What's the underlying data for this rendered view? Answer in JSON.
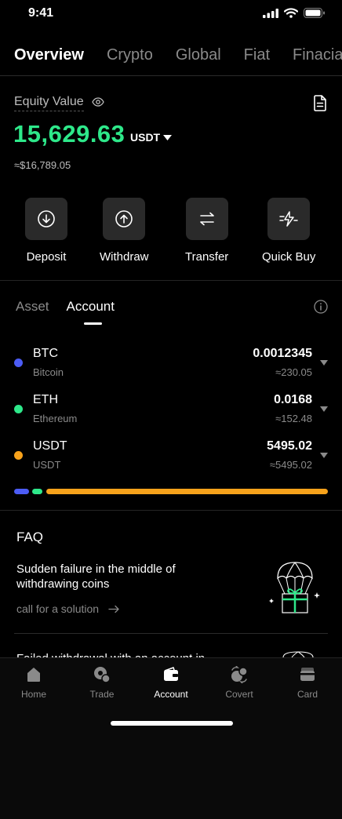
{
  "status_bar": {
    "time": "9:41"
  },
  "top_tabs": [
    {
      "label": "Overview",
      "active": true
    },
    {
      "label": "Crypto"
    },
    {
      "label": "Global"
    },
    {
      "label": "Fiat"
    },
    {
      "label": "Finacial"
    }
  ],
  "equity": {
    "label": "Equity Value",
    "value": "15,629.63",
    "currency": "USDT",
    "approx": "≈$16,789.05"
  },
  "actions": [
    {
      "label": "Deposit",
      "icon": "deposit-icon"
    },
    {
      "label": "Withdraw",
      "icon": "withdraw-icon"
    },
    {
      "label": "Transfer",
      "icon": "transfer-icon"
    },
    {
      "label": "Quick Buy",
      "icon": "quick-buy-icon"
    }
  ],
  "sub_tabs": [
    {
      "label": "Asset"
    },
    {
      "label": "Account",
      "active": true
    }
  ],
  "assets": [
    {
      "symbol": "BTC",
      "name": "Bitcoin",
      "amount": "0.0012345",
      "approx": "≈230.05",
      "color": "#4c5cf5"
    },
    {
      "symbol": "ETH",
      "name": "Ethereum",
      "amount": "0.0168",
      "approx": "≈152.48",
      "color": "#2ee88a"
    },
    {
      "symbol": "USDT",
      "name": "USDT",
      "amount": "5495.02",
      "approx": "≈5495.02",
      "color": "#f7a21b"
    }
  ],
  "faq": {
    "title": "FAQ",
    "items": [
      {
        "question": "Sudden failure in the middle of withdrawing coins",
        "link": "call for a solution"
      },
      {
        "question": "Failed withdrawal with an account in"
      }
    ]
  },
  "bottom_nav": [
    {
      "label": "Home",
      "icon": "home-icon"
    },
    {
      "label": "Trade",
      "icon": "trade-icon"
    },
    {
      "label": "Account",
      "icon": "wallet-icon",
      "active": true
    },
    {
      "label": "Covert",
      "icon": "convert-icon"
    },
    {
      "label": "Card",
      "icon": "card-icon"
    }
  ],
  "colors": {
    "accent": "#2ee88a",
    "background": "#000000",
    "surface": "#2a2a2a"
  }
}
